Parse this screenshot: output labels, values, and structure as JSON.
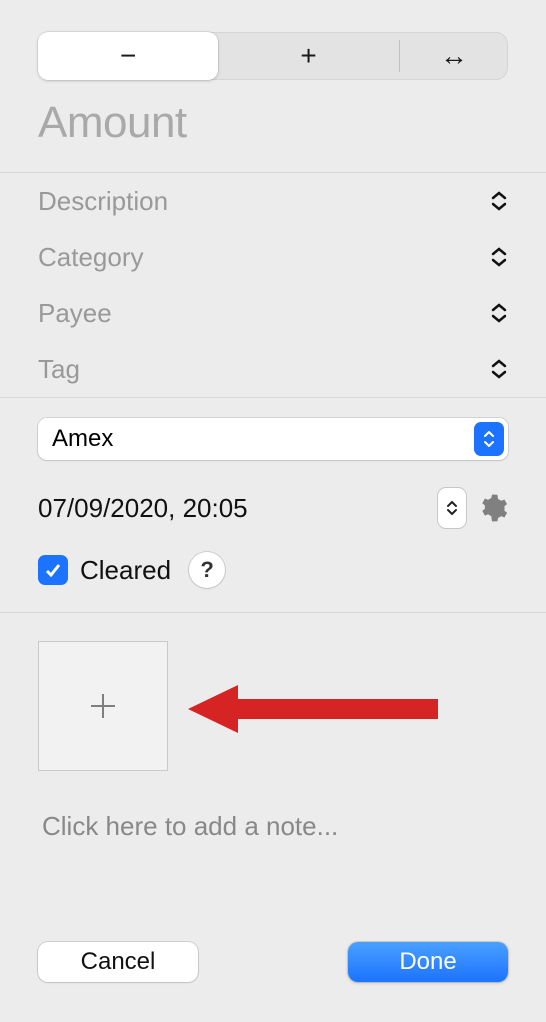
{
  "segments": {
    "minus_symbol": "−",
    "plus_symbol": "+",
    "transfer_symbol": "↔"
  },
  "amount": {
    "placeholder": "Amount"
  },
  "fields": {
    "description": "Description",
    "category": "Category",
    "payee": "Payee",
    "tag": "Tag"
  },
  "account": {
    "selected": "Amex"
  },
  "datetime": {
    "value": "07/09/2020, 20:05"
  },
  "cleared": {
    "label": "Cleared",
    "checked": true
  },
  "help": {
    "label": "?"
  },
  "note": {
    "placeholder": "Click here to add a note..."
  },
  "footer": {
    "cancel": "Cancel",
    "done": "Done"
  }
}
